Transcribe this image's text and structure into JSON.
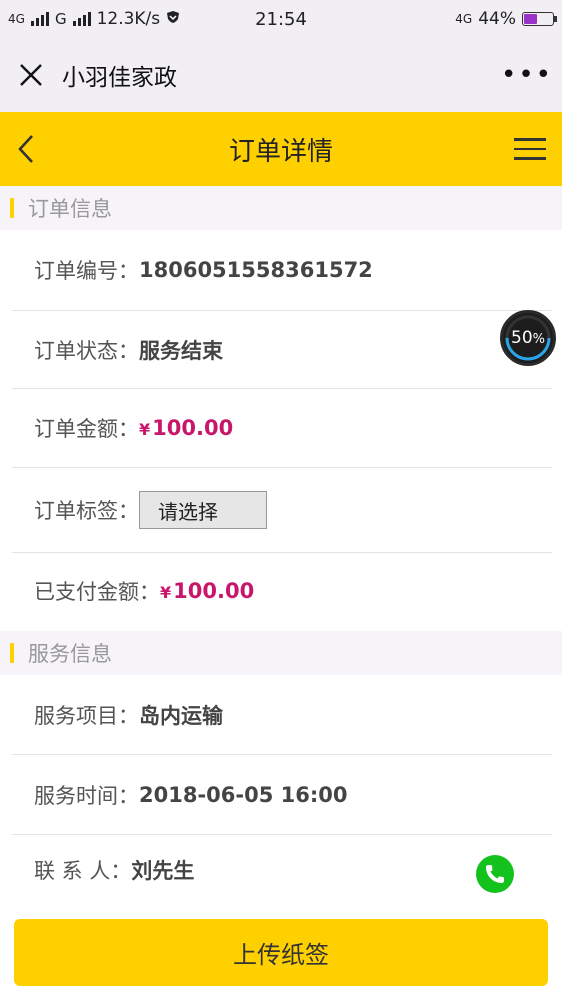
{
  "status_bar": {
    "network_1": "4G",
    "network_2": "G",
    "speed": "12.3K/s",
    "time": "21:54",
    "network_3": "4G",
    "battery": "44%",
    "battery_level": 0.44
  },
  "wechat_bar": {
    "title": "小羽佳家政",
    "more": "•••"
  },
  "nav": {
    "title": "订单详情"
  },
  "order_section": {
    "title": "订单信息",
    "order_no_label": "订单编号：",
    "order_no": "1806051558361572",
    "status_label": "订单状态：",
    "status": "服务结束",
    "amount_label": "订单金额：",
    "amount_currency": "¥",
    "amount": "100.00",
    "tag_label": "订单标签：",
    "tag_select": "请选择",
    "paid_label": "已支付金额：",
    "paid_currency": "¥",
    "paid": "100.00"
  },
  "service_section": {
    "title": "服务信息",
    "item_label": "服务项目：",
    "item": "岛内运输",
    "time_label": "服务时间：",
    "time": "2018-06-05 16:00",
    "contact_label": "联 系 人：",
    "contact": "刘先生"
  },
  "overlay_badge": {
    "percent": "50",
    "percent_sign": "%"
  },
  "footer": {
    "upload_label": "上传纸签"
  },
  "colors": {
    "accent": "#ffd000",
    "money": "#c8176a",
    "phone": "#14c21e"
  }
}
